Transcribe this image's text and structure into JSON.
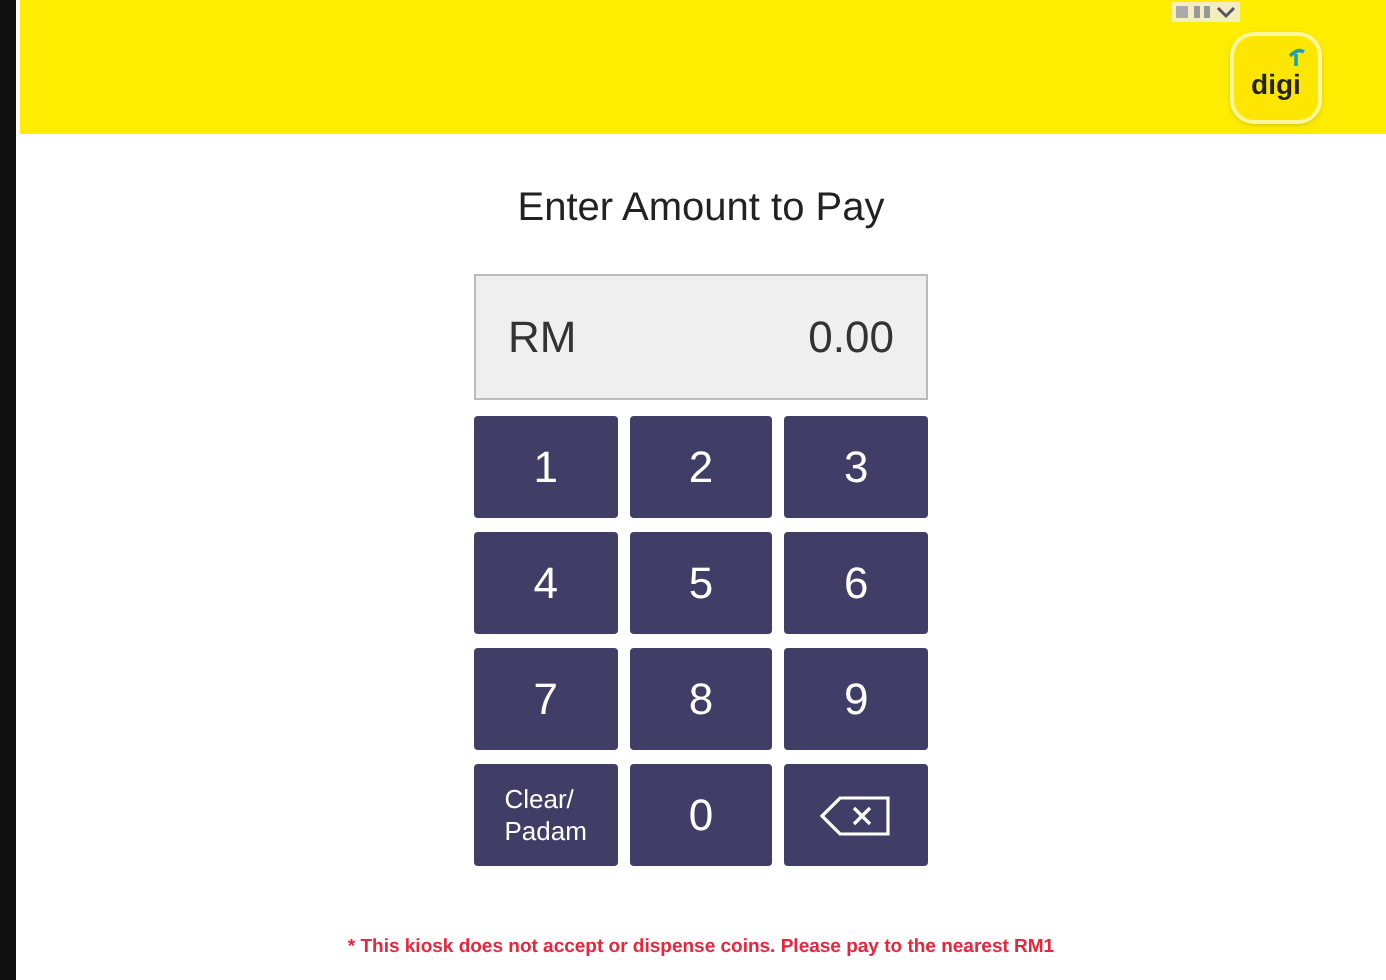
{
  "header": {
    "logo_text": "digi"
  },
  "title": "Enter Amount to Pay",
  "display": {
    "currency": "RM",
    "amount": "0.00"
  },
  "keys": [
    {
      "kind": "digit",
      "label": "1"
    },
    {
      "kind": "digit",
      "label": "2"
    },
    {
      "kind": "digit",
      "label": "3"
    },
    {
      "kind": "digit",
      "label": "4"
    },
    {
      "kind": "digit",
      "label": "5"
    },
    {
      "kind": "digit",
      "label": "6"
    },
    {
      "kind": "digit",
      "label": "7"
    },
    {
      "kind": "digit",
      "label": "8"
    },
    {
      "kind": "digit",
      "label": "9"
    },
    {
      "kind": "clear",
      "label": "Clear/\nPadam"
    },
    {
      "kind": "digit",
      "label": "0"
    },
    {
      "kind": "backspace"
    }
  ],
  "note": "* This kiosk does not accept or dispense coins. Please pay to the nearest RM1"
}
